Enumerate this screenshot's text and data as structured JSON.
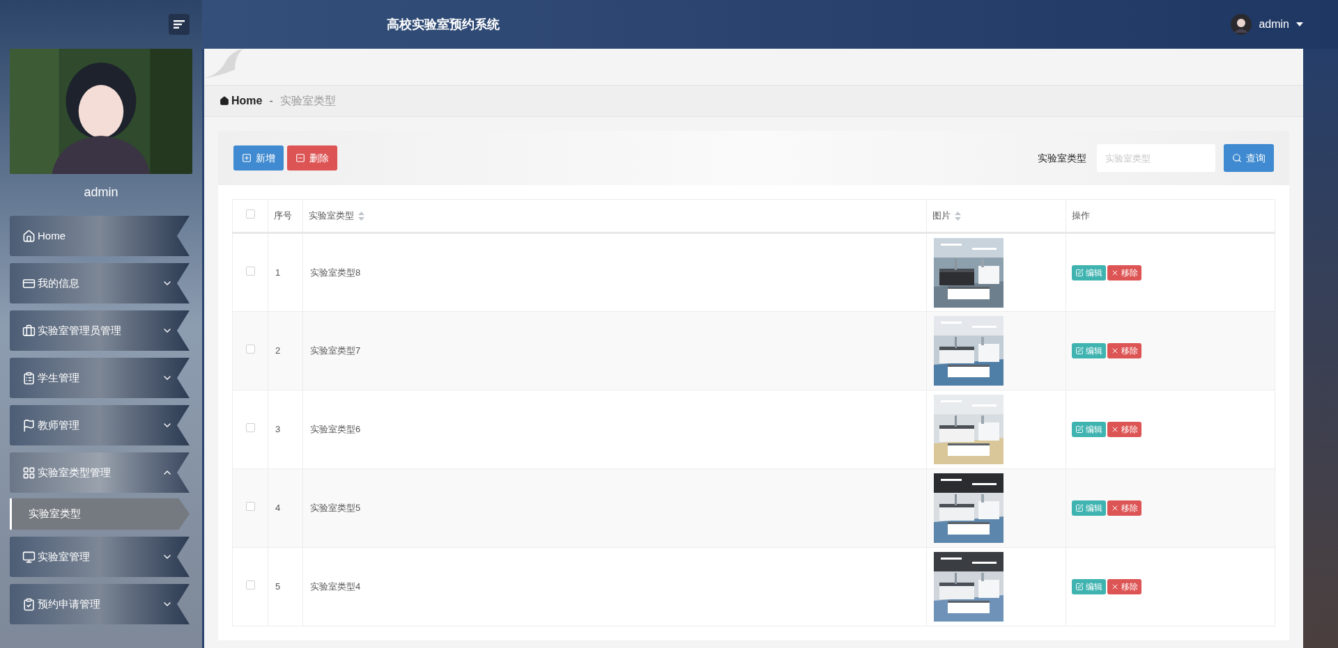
{
  "header": {
    "title": "高校实验室预约系统",
    "user": "admin"
  },
  "sidebar": {
    "username": "admin",
    "items": [
      {
        "label": "Home",
        "kind": "link"
      },
      {
        "label": "我的信息",
        "kind": "group",
        "expanded": false
      },
      {
        "label": "实验室管理员管理",
        "kind": "group",
        "expanded": false
      },
      {
        "label": "学生管理",
        "kind": "group",
        "expanded": false
      },
      {
        "label": "教师管理",
        "kind": "group",
        "expanded": false
      },
      {
        "label": "实验室类型管理",
        "kind": "group",
        "expanded": true,
        "children": [
          {
            "label": "实验室类型",
            "selected": true
          }
        ]
      },
      {
        "label": "实验室管理",
        "kind": "group",
        "expanded": false
      },
      {
        "label": "预约申请管理",
        "kind": "group",
        "expanded": false
      }
    ]
  },
  "breadcrumb": {
    "home": "Home",
    "separator": "-",
    "current": "实验室类型"
  },
  "toolbar": {
    "buttons": [
      {
        "label": "新增",
        "kind": "add"
      },
      {
        "label": "删除",
        "kind": "delete"
      }
    ],
    "search": {
      "label": "实验室类型",
      "placeholder": "实验室类型",
      "button": "查询"
    }
  },
  "table": {
    "select_all": {
      "checked": false
    },
    "columns": [
      {
        "label": "序号",
        "sortable": false
      },
      {
        "label": "实验室类型",
        "sortable": true
      },
      {
        "label": "图片",
        "sortable": true
      },
      {
        "label": "操作",
        "sortable": false
      }
    ],
    "rows": [
      {
        "checked": false,
        "index": "1",
        "name": "实验室类型8",
        "actions": {
          "edit": "编辑",
          "remove": "移除"
        }
      },
      {
        "checked": false,
        "index": "2",
        "name": "实验室类型7",
        "actions": {
          "edit": "编辑",
          "remove": "移除"
        }
      },
      {
        "checked": false,
        "index": "3",
        "name": "实验室类型6",
        "actions": {
          "edit": "编辑",
          "remove": "移除"
        }
      },
      {
        "checked": false,
        "index": "4",
        "name": "实验室类型5",
        "actions": {
          "edit": "编辑",
          "remove": "移除"
        }
      },
      {
        "checked": false,
        "index": "5",
        "name": "实验室类型4",
        "actions": {
          "edit": "编辑",
          "remove": "移除"
        }
      }
    ]
  }
}
